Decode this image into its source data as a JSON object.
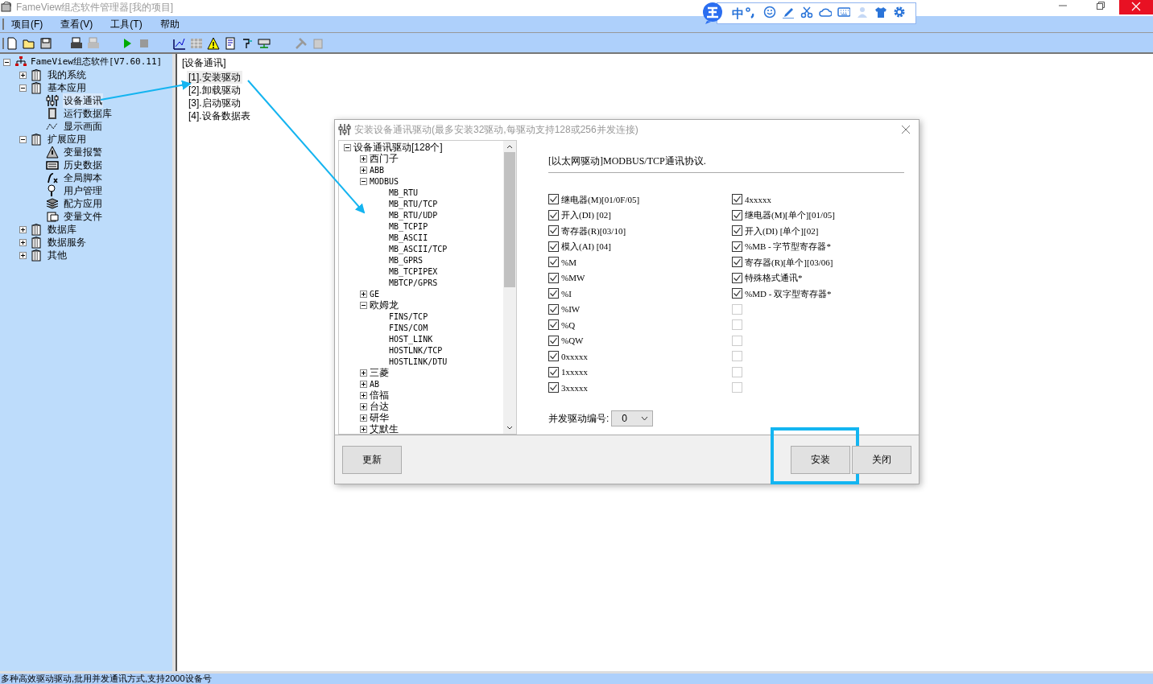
{
  "window": {
    "title": "FameView组态软件管理器[我的项目]"
  },
  "menu": [
    "项目(F)",
    "查看(V)",
    "工具(T)",
    "帮助"
  ],
  "ime_toolbar": {
    "mode": "中"
  },
  "tree": [
    {
      "label": "FameView组态软件[V7.60.11]",
      "expanded": true,
      "children": [
        {
          "label": "我的系统",
          "expanded": false
        },
        {
          "label": "基本应用",
          "expanded": true,
          "children": [
            {
              "label": "设备通讯",
              "selected": true
            },
            {
              "label": "运行数据库",
              "selected": false
            },
            {
              "label": "显示画面",
              "selected": false
            }
          ]
        },
        {
          "label": "扩展应用",
          "expanded": true,
          "children": [
            {
              "label": "变量报警",
              "selected": false
            },
            {
              "label": "历史数据",
              "selected": false
            },
            {
              "label": "全局脚本",
              "selected": false
            },
            {
              "label": "用户管理",
              "selected": false
            },
            {
              "label": "配方应用",
              "selected": false
            },
            {
              "label": "变量文件",
              "selected": false
            }
          ]
        },
        {
          "label": "数据库",
          "expanded": false
        },
        {
          "label": "数据服务",
          "expanded": false
        },
        {
          "label": "其他",
          "expanded": false
        }
      ]
    }
  ],
  "content": {
    "heading": "[设备通讯]",
    "items": [
      {
        "label": "[1].安装驱动",
        "selected": true
      },
      {
        "label": "[2].卸载驱动",
        "selected": false
      },
      {
        "label": "[3].启动驱动",
        "selected": false
      },
      {
        "label": "[4].设备数据表",
        "selected": false
      }
    ]
  },
  "dialog": {
    "title": "安装设备通讯驱动(最多安装32驱动,每驱动支持128或256并发连接)",
    "tree": {
      "label": "设备通讯驱动[128个]",
      "expanded": true,
      "children": [
        {
          "label": "西门子",
          "expanded": false
        },
        {
          "label": "ABB",
          "expanded": false
        },
        {
          "label": "MODBUS",
          "expanded": true,
          "children": [
            {
              "label": "MB_RTU"
            },
            {
              "label": "MB_RTU/TCP"
            },
            {
              "label": "MB_RTU/UDP"
            },
            {
              "label": "MB_TCPIP"
            },
            {
              "label": "MB_ASCII"
            },
            {
              "label": "MB_ASCII/TCP"
            },
            {
              "label": "MB_GPRS"
            },
            {
              "label": "MB_TCPIPEX"
            },
            {
              "label": "MBTCP/GPRS"
            }
          ]
        },
        {
          "label": "GE",
          "expanded": false
        },
        {
          "label": "欧姆龙",
          "expanded": true,
          "children": [
            {
              "label": "FINS/TCP"
            },
            {
              "label": "FINS/COM"
            },
            {
              "label": "HOST_LINK"
            },
            {
              "label": "HOSTLNK/TCP"
            },
            {
              "label": "HOSTLINK/DTU"
            }
          ]
        },
        {
          "label": "三菱",
          "expanded": false
        },
        {
          "label": "AB",
          "expanded": false
        },
        {
          "label": "倍福",
          "expanded": false
        },
        {
          "label": "台达",
          "expanded": false
        },
        {
          "label": "研华",
          "expanded": false
        },
        {
          "label": "艾默生",
          "expanded": false
        }
      ]
    },
    "description": "[以太网驱动]MODBUS/TCP通讯协议.",
    "options_left": [
      {
        "label": "继电器(M)[01/0F/05]",
        "checked": true
      },
      {
        "label": "开入(DI) [02]",
        "checked": true
      },
      {
        "label": "寄存器(R)[03/10]",
        "checked": true
      },
      {
        "label": "模入(AI) [04]",
        "checked": true
      },
      {
        "label": "%M",
        "checked": true
      },
      {
        "label": "%MW",
        "checked": true
      },
      {
        "label": "%I",
        "checked": true
      },
      {
        "label": "%IW",
        "checked": true
      },
      {
        "label": "%Q",
        "checked": true
      },
      {
        "label": "%QW",
        "checked": true
      },
      {
        "label": "0xxxxx",
        "checked": true
      },
      {
        "label": "1xxxxx",
        "checked": true
      },
      {
        "label": "3xxxxx",
        "checked": true
      }
    ],
    "options_right": [
      {
        "label": "4xxxxx",
        "checked": true
      },
      {
        "label": "继电器(M)[单个][01/05]",
        "checked": true
      },
      {
        "label": "开入(DI) [单个][02]",
        "checked": true
      },
      {
        "label": "%MB - 字节型寄存器*",
        "checked": true
      },
      {
        "label": "寄存器(R)[单个][03/06]",
        "checked": true
      },
      {
        "label": "特殊格式通讯*",
        "checked": true
      },
      {
        "label": "%MD - 双字型寄存器*",
        "checked": true
      },
      {
        "checked": false
      },
      {
        "checked": false
      },
      {
        "checked": false
      },
      {
        "checked": false
      },
      {
        "checked": false
      },
      {
        "checked": false
      }
    ],
    "driver_number": {
      "label": "并发驱动编号:",
      "value": "0"
    },
    "buttons": [
      {
        "label": "更新",
        "highlighted": false
      },
      {
        "label": "安装",
        "highlighted": true
      },
      {
        "label": "关闭",
        "highlighted": false
      }
    ]
  },
  "status_bar": "多种高效驱动驱动,批用并发通讯方式,支持2000设备号"
}
